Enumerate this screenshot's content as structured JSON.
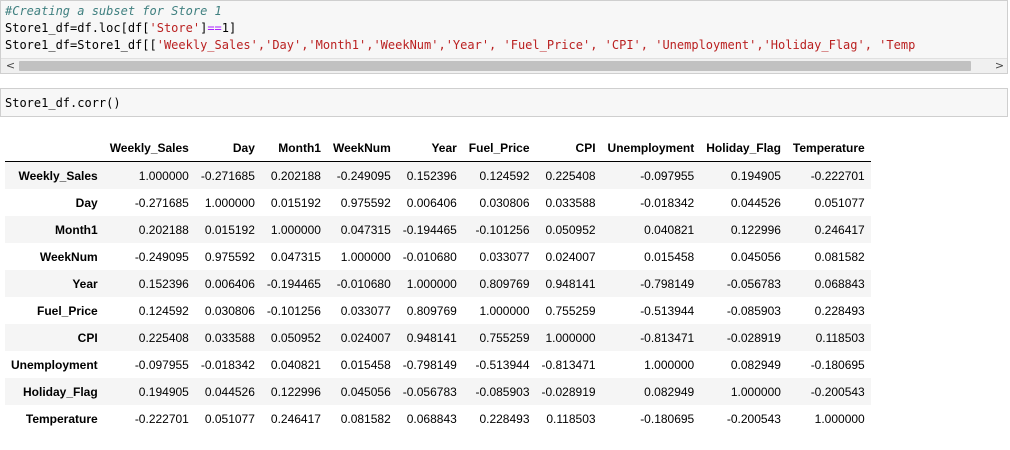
{
  "cell1": {
    "comment": "#Creating a subset for Store 1",
    "line2": {
      "a": "Store1_df=df.loc[df[",
      "b": "'Store'",
      "c": "]",
      "d": "==",
      "e": "1]"
    },
    "line3": {
      "a": "Store1_df=Store1_df[[",
      "cols": "'Weekly_Sales','Day','Month1','WeekNum','Year', 'Fuel_Price', 'CPI', 'Unemployment','Holiday_Flag', 'Temp"
    },
    "scroll_left": "<",
    "scroll_right": ">"
  },
  "cell2": {
    "code": "Store1_df.corr()"
  },
  "table": {
    "headers": [
      "",
      "Weekly_Sales",
      "Day",
      "Month1",
      "WeekNum",
      "Year",
      "Fuel_Price",
      "CPI",
      "Unemployment",
      "Holiday_Flag",
      "Temperature"
    ],
    "rows": [
      [
        "Weekly_Sales",
        "1.000000",
        "-0.271685",
        "0.202188",
        "-0.249095",
        "0.152396",
        "0.124592",
        "0.225408",
        "-0.097955",
        "0.194905",
        "-0.222701"
      ],
      [
        "Day",
        "-0.271685",
        "1.000000",
        "0.015192",
        "0.975592",
        "0.006406",
        "0.030806",
        "0.033588",
        "-0.018342",
        "0.044526",
        "0.051077"
      ],
      [
        "Month1",
        "0.202188",
        "0.015192",
        "1.000000",
        "0.047315",
        "-0.194465",
        "-0.101256",
        "0.050952",
        "0.040821",
        "0.122996",
        "0.246417"
      ],
      [
        "WeekNum",
        "-0.249095",
        "0.975592",
        "0.047315",
        "1.000000",
        "-0.010680",
        "0.033077",
        "0.024007",
        "0.015458",
        "0.045056",
        "0.081582"
      ],
      [
        "Year",
        "0.152396",
        "0.006406",
        "-0.194465",
        "-0.010680",
        "1.000000",
        "0.809769",
        "0.948141",
        "-0.798149",
        "-0.056783",
        "0.068843"
      ],
      [
        "Fuel_Price",
        "0.124592",
        "0.030806",
        "-0.101256",
        "0.033077",
        "0.809769",
        "1.000000",
        "0.755259",
        "-0.513944",
        "-0.085903",
        "0.228493"
      ],
      [
        "CPI",
        "0.225408",
        "0.033588",
        "0.050952",
        "0.024007",
        "0.948141",
        "0.755259",
        "1.000000",
        "-0.813471",
        "-0.028919",
        "0.118503"
      ],
      [
        "Unemployment",
        "-0.097955",
        "-0.018342",
        "0.040821",
        "0.015458",
        "-0.798149",
        "-0.513944",
        "-0.813471",
        "1.000000",
        "0.082949",
        "-0.180695"
      ],
      [
        "Holiday_Flag",
        "0.194905",
        "0.044526",
        "0.122996",
        "0.045056",
        "-0.056783",
        "-0.085903",
        "-0.028919",
        "0.082949",
        "1.000000",
        "-0.200543"
      ],
      [
        "Temperature",
        "-0.222701",
        "0.051077",
        "0.246417",
        "0.081582",
        "0.068843",
        "0.228493",
        "0.118503",
        "-0.180695",
        "-0.200543",
        "1.000000"
      ]
    ]
  }
}
